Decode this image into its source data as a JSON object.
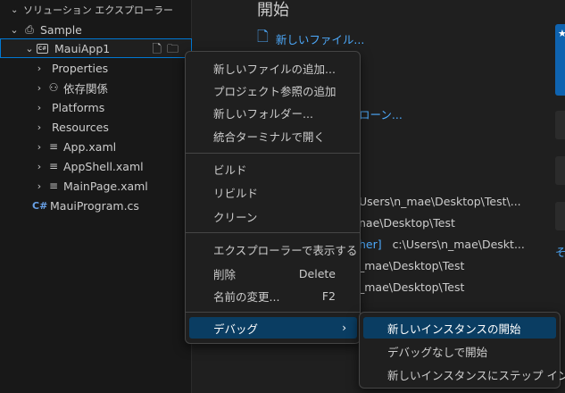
{
  "explorer": {
    "header": "ソリューション エクスプローラー",
    "solution": "Sample",
    "project": "MauiApp1",
    "project_badge": "C#",
    "items": [
      {
        "label": "Properties",
        "icon": "chevron-only"
      },
      {
        "label": "依存関係",
        "icon": "dependencies-icon"
      },
      {
        "label": "Platforms",
        "icon": "chevron-only"
      },
      {
        "label": "Resources",
        "icon": "chevron-only"
      },
      {
        "label": "App.xaml",
        "icon": "xaml-icon"
      },
      {
        "label": "AppShell.xaml",
        "icon": "xaml-icon"
      },
      {
        "label": "MainPage.xaml",
        "icon": "xaml-icon"
      },
      {
        "label": "MauiProgram.cs",
        "icon": "csharp-icon"
      }
    ]
  },
  "welcome": {
    "title": "開始",
    "new_file": "新しいファイル...",
    "clone_partial": "ローン...",
    "walkthrough_partial": "そ",
    "recent": [
      {
        "name": "",
        "path": "Users\\n_mae\\Desktop\\Test\\..."
      },
      {
        "name": "",
        "path": "nae\\Desktop\\Test"
      },
      {
        "name": "her]",
        "path": "c:\\Users\\n_mae\\Deskt..."
      },
      {
        "name": "",
        "path": "_mae\\Desktop\\Test"
      },
      {
        "name": "",
        "path": "_mae\\Desktop\\Test"
      }
    ]
  },
  "context_menu": {
    "group1": [
      "新しいファイルの追加...",
      "プロジェクト参照の追加",
      "新しいフォルダー...",
      "統合ターミナルで開く"
    ],
    "group2": [
      "ビルド",
      "リビルド",
      "クリーン"
    ],
    "group3": [
      {
        "label": "エクスプローラーで表示する",
        "shortcut": ""
      },
      {
        "label": "削除",
        "shortcut": "Delete"
      },
      {
        "label": "名前の変更...",
        "shortcut": "F2"
      }
    ],
    "debug": {
      "label": "デバッグ",
      "arrow": "›"
    }
  },
  "submenu": {
    "items": [
      "新しいインスタンスの開始",
      "デバッグなしで開始",
      "新しいインスタンスにステップ イン"
    ]
  },
  "colors": {
    "accent": "#0078d4",
    "link": "#4daafc",
    "menu_highlight": "#0a3d62"
  }
}
